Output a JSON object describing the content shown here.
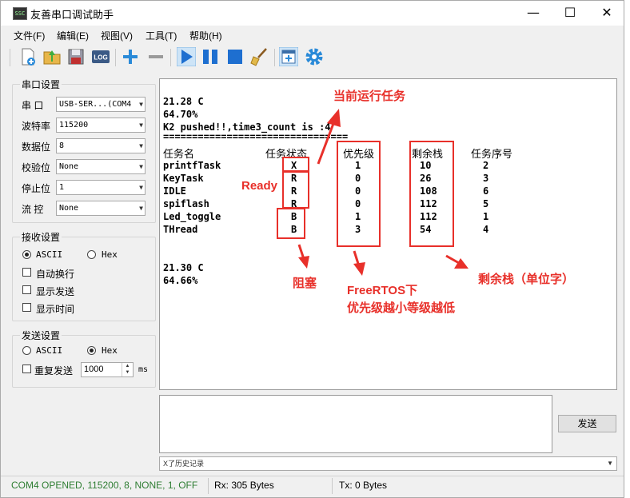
{
  "window": {
    "icon_text": "SSC",
    "title": "友善串口调试助手",
    "min": "—",
    "max": "☐",
    "close": "✕"
  },
  "menu": [
    "文件(F)",
    "编辑(E)",
    "视图(V)",
    "工具(T)",
    "帮助(H)"
  ],
  "toolbar": {
    "log_label": "LOG"
  },
  "serial": {
    "title": "串口设置",
    "port_label": "串  口",
    "port_value": "USB-SER...(COM4",
    "baud_label": "波特率",
    "baud_value": "115200",
    "databits_label": "数据位",
    "databits_value": "8",
    "parity_label": "校验位",
    "parity_value": "None",
    "stopbits_label": "停止位",
    "stopbits_value": "1",
    "flow_label": "流  控",
    "flow_value": "None"
  },
  "receive": {
    "title": "接收设置",
    "ascii": "ASCII",
    "hex": "Hex",
    "autowrap": "自动换行",
    "showsend": "显示发送",
    "showtime": "显示时间"
  },
  "send": {
    "title": "发送设置",
    "ascii": "ASCII",
    "hex": "Hex",
    "repeat": "重复发送",
    "interval": "1000",
    "unit": "ms",
    "button": "发送",
    "history": "X了历史记录"
  },
  "rx": {
    "lines": [
      "21.28 C",
      "64.70%",
      "K2 pushed!!,time3_count is :4",
      "================================"
    ],
    "headers": [
      "任务名",
      "任务状态",
      "优先级",
      "剩余栈",
      "任务序号"
    ],
    "tasks": [
      {
        "name": "printfTask",
        "state": "X",
        "prio": "1",
        "stack": "10",
        "num": "2"
      },
      {
        "name": "KeyTask",
        "state": "R",
        "prio": "0",
        "stack": "26",
        "num": "3"
      },
      {
        "name": "IDLE",
        "state": "R",
        "prio": "0",
        "stack": "108",
        "num": "6"
      },
      {
        "name": "spiflash",
        "state": "R",
        "prio": "0",
        "stack": "112",
        "num": "5"
      },
      {
        "name": "Led_toggle",
        "state": "B",
        "prio": "1",
        "stack": "112",
        "num": "1"
      },
      {
        "name": "THread",
        "state": "B",
        "prio": "3",
        "stack": "54",
        "num": "4"
      }
    ],
    "tail": [
      "21.30 C",
      "64.66%"
    ]
  },
  "annotations": {
    "running": "当前运行任务",
    "ready": "Ready",
    "blocked": "阻塞",
    "freertos_l1": "FreeRTOS下",
    "freertos_l2": "优先级越小等级越低",
    "stack": "剩余栈（单位字）"
  },
  "status": {
    "port": "COM4 OPENED, 115200, 8, NONE, 1, OFF",
    "rx": "Rx: 305 Bytes",
    "tx": "Tx: 0 Bytes"
  },
  "colors": {
    "status_green": "#2e7d32",
    "annotation_red": "#e8302a",
    "toolbar_blue": "#1e6fd0"
  }
}
